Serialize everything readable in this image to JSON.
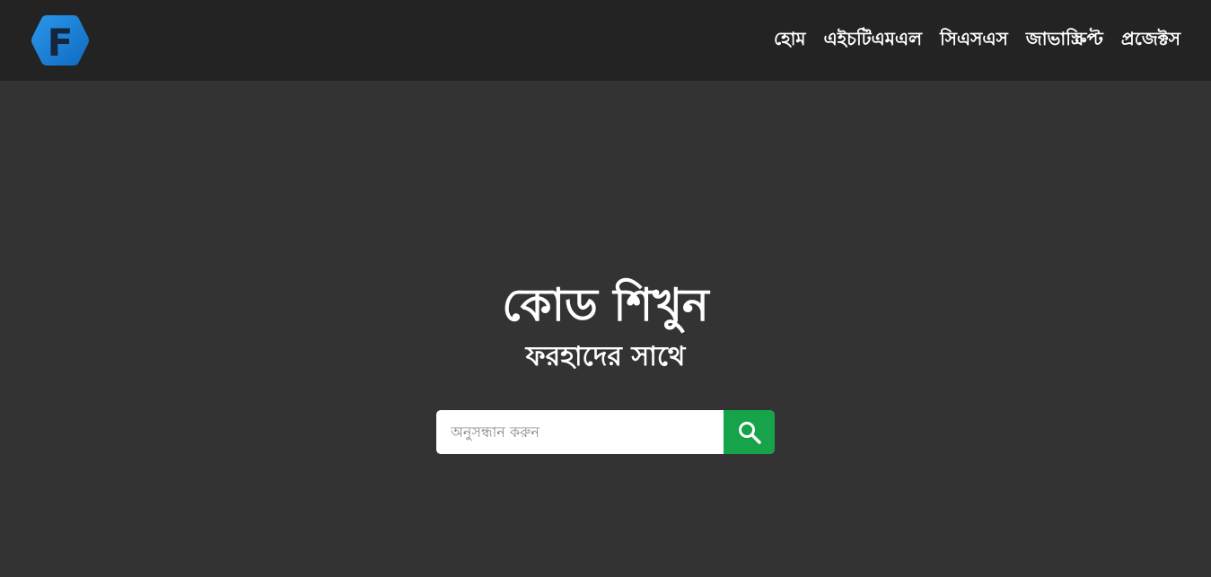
{
  "brand": {
    "logo_letter": "F",
    "logo_color": "#1f7fd6"
  },
  "nav": {
    "items": [
      {
        "label": "হোম"
      },
      {
        "label": "এইচটিএমএল"
      },
      {
        "label": "সিএসএস"
      },
      {
        "label": "জাভাস্ক্রিপ্ট"
      },
      {
        "label": "প্রজেক্টস"
      }
    ]
  },
  "hero": {
    "title": "কোড শিখুন",
    "subtitle": "ফরহাদের সাথে"
  },
  "search": {
    "placeholder": "অনুসন্ধান করুন",
    "button_icon": "search-icon",
    "button_color": "#16a34a"
  },
  "colors": {
    "navbar_bg": "#232323",
    "page_bg": "#333333"
  }
}
